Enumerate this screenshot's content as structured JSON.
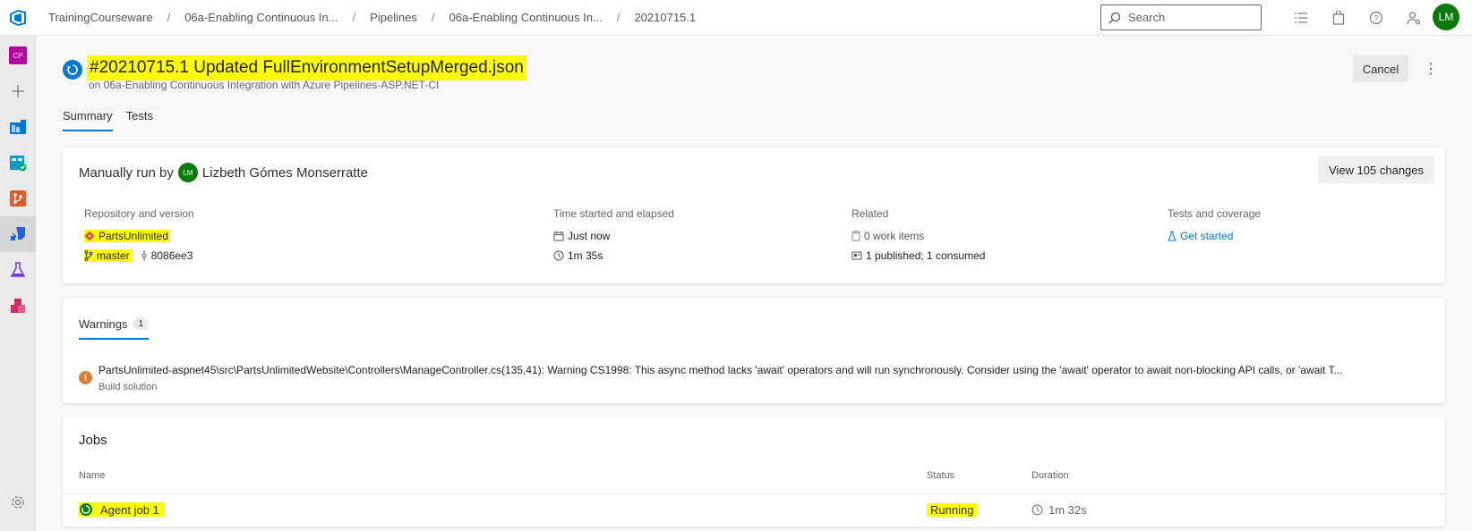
{
  "breadcrumbs": [
    "TrainingCourseware",
    "06a-Enabling Continuous In...",
    "Pipelines",
    "06a-Enabling Continuous In...",
    "20210715.1"
  ],
  "search": {
    "placeholder": "Search"
  },
  "user": {
    "initials": "LM"
  },
  "rail": {
    "project_badge": "CP"
  },
  "run": {
    "title": "#20210715.1 Updated FullEnvironmentSetupMerged.json",
    "subtitle": "on 06a-Enabling Continuous Integration with Azure Pipelines-ASP.NET-CI",
    "cancel_label": "Cancel",
    "more_label": "⋮"
  },
  "tabs": [
    "Summary",
    "Tests"
  ],
  "summary": {
    "manual_prefix": "Manually run by",
    "user_initials": "LM",
    "user_name": "Lizbeth Gómes Monserratte",
    "view_changes_label": "View 105 changes",
    "repo_header": "Repository and version",
    "repo_name": "PartsUnlimited",
    "branch": "master",
    "commit": "8086ee3",
    "time_header": "Time started and elapsed",
    "started": "Just now",
    "elapsed": "1m 35s",
    "related_header": "Related",
    "work_items": "0 work items",
    "artifacts": "1 published; 1 consumed",
    "tests_header": "Tests and coverage",
    "tests_link": "Get started"
  },
  "warnings": {
    "tab_label": "Warnings",
    "count": "1",
    "icon_glyph": "!",
    "message": "PartsUnlimited-aspnet45\\src\\PartsUnlimitedWebsite\\Controllers\\ManageController.cs(135,41): Warning CS1998: This async method lacks 'await' operators and will run synchronously. Consider using the 'await' operator to await non-blocking API calls, or 'await T...",
    "source": "Build solution"
  },
  "jobs": {
    "title": "Jobs",
    "columns": {
      "name": "Name",
      "status": "Status",
      "duration": "Duration"
    },
    "rows": [
      {
        "name": "Agent job 1",
        "status": "Running",
        "duration": "1m 32s"
      }
    ]
  },
  "colors": {
    "accent": "#0078d4",
    "highlight": "#ffff00",
    "avatar": "#0b7a0b",
    "warning": "#d67f3c",
    "project_badge": "#b4009e"
  }
}
